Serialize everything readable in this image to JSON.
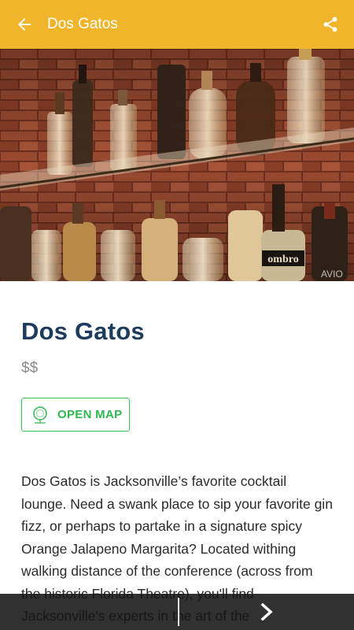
{
  "header": {
    "title": "Dos Gatos",
    "background": "#f1b52b",
    "back_icon": "arrow-left-icon",
    "share_icon": "share-icon"
  },
  "hero": {
    "bottle_label_text": "ombro",
    "watermark": "AVIO"
  },
  "venue": {
    "name": "Dos Gatos",
    "price": "$$",
    "map_button_label": "OPEN MAP",
    "map_icon": "map-pin-icon",
    "description": "Dos Gatos is Jacksonville’s favorite cocktail lounge. Need a swank place to sip your favorite gin fizz, or perhaps to partake in a signature spicy Orange Jalapeno Margarita? Located withing walking distance of the conference (across from the historic Florida Theatre), you'll find Jacksonville's experts in the art of the"
  },
  "bottom_bar": {
    "next_icon": "chevron-right-icon"
  },
  "colors": {
    "title": "#1d3b5c",
    "accent_green": "#2eb84f"
  }
}
